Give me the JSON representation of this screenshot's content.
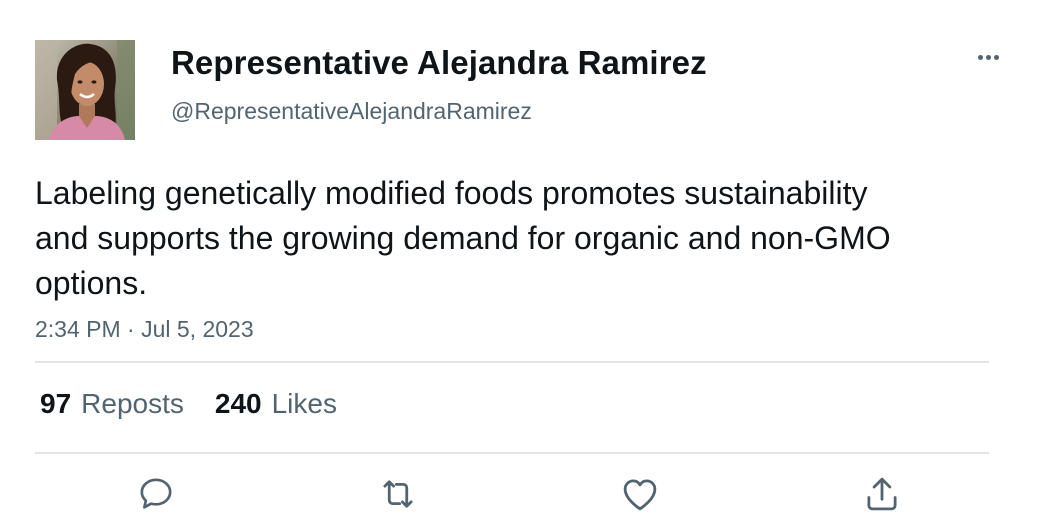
{
  "author": {
    "display_name": "Representative Alejandra Ramirez",
    "handle": "@RepresentativeAlejandraRamirez",
    "avatar_icon": "profile-photo"
  },
  "tweet": {
    "text": "Labeling genetically modified foods promotes sustainability and supports the growing demand for organic and non-GMO options.",
    "timestamp": "2:34 PM · Jul 5, 2023"
  },
  "stats": {
    "reposts_count": "97",
    "reposts_label": "Reposts",
    "likes_count": "240",
    "likes_label": "Likes"
  },
  "actions": [
    {
      "name": "reply",
      "icon": "speech-bubble-icon"
    },
    {
      "name": "repost",
      "icon": "repost-arrows-icon"
    },
    {
      "name": "like",
      "icon": "heart-icon"
    },
    {
      "name": "share",
      "icon": "share-upload-icon"
    }
  ],
  "colors": {
    "text_primary": "#0f1419",
    "text_secondary": "#536471",
    "divider": "#e1e5e8",
    "background": "#ffffff"
  }
}
